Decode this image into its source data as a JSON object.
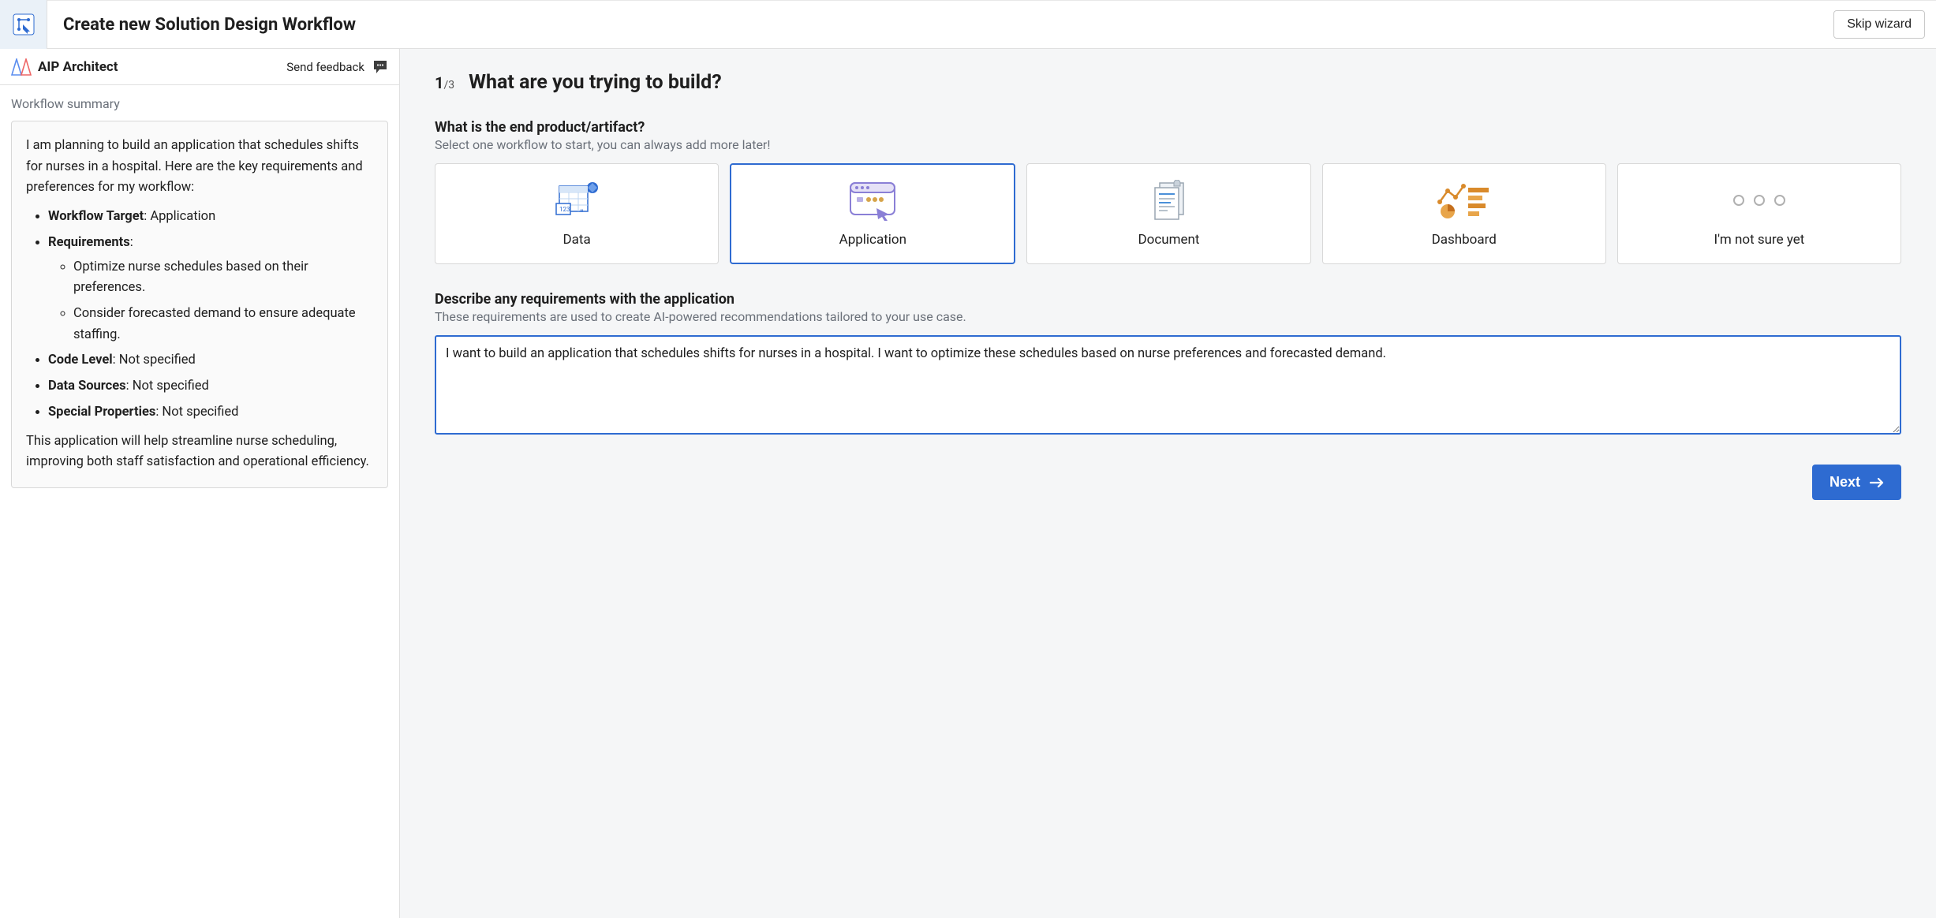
{
  "header": {
    "title": "Create new Solution Design Workflow",
    "skip_label": "Skip wizard"
  },
  "sidebar": {
    "title": "AIP Architect",
    "feedback_label": "Send feedback",
    "summary_label": "Workflow summary",
    "summary_intro": "I am planning to build an application that schedules shifts for nurses in a hospital. Here are the key requirements and preferences for my workflow:",
    "bullets": {
      "target_label": "Workflow Target",
      "target_value": ": Application",
      "req_label": "Requirements",
      "req_colon": ":",
      "req_items": [
        "Optimize nurse schedules based on their preferences.",
        "Consider forecasted demand to ensure adequate staffing."
      ],
      "code_label": "Code Level",
      "code_value": ": Not specified",
      "data_label": "Data Sources",
      "data_value": ": Not specified",
      "special_label": "Special Properties",
      "special_value": ": Not specified"
    },
    "summary_outro": "This application will help streamline nurse scheduling, improving both staff satisfaction and operational efficiency."
  },
  "step": {
    "current": "1",
    "total": "/3",
    "title": "What are you trying to build?"
  },
  "artifact": {
    "heading": "What is the end product/artifact?",
    "sub": "Select one workflow to start, you can always add more later!",
    "options": [
      {
        "id": "data",
        "label": "Data",
        "selected": false
      },
      {
        "id": "application",
        "label": "Application",
        "selected": true
      },
      {
        "id": "document",
        "label": "Document",
        "selected": false
      },
      {
        "id": "dashboard",
        "label": "Dashboard",
        "selected": false
      },
      {
        "id": "notsure",
        "label": "I'm not sure yet",
        "selected": false
      }
    ]
  },
  "describe": {
    "heading": "Describe any requirements with the application",
    "sub": "These requirements are used to create AI-powered recommendations tailored to your use case.",
    "value": "I want to build an application that schedules shifts for nurses in a hospital. I want to optimize these schedules based on nurse preferences and forecasted demand."
  },
  "footer": {
    "next_label": "Next"
  }
}
